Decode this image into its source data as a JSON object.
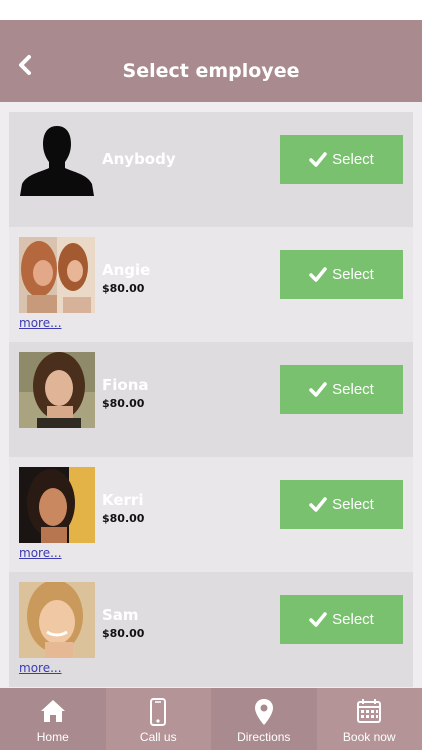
{
  "header": {
    "title": "Select employee",
    "back_icon": "chevron-left-icon"
  },
  "employees": [
    {
      "name": "Anybody",
      "price": "",
      "more": "",
      "select_label": "Select"
    },
    {
      "name": "Angie",
      "price": "$80.00",
      "more": "more...",
      "select_label": "Select"
    },
    {
      "name": "Fiona",
      "price": "$80.00",
      "more": "",
      "select_label": "Select"
    },
    {
      "name": "Kerri",
      "price": "$80.00",
      "more": "more...",
      "select_label": "Select"
    },
    {
      "name": "Sam",
      "price": "$80.00",
      "more": "more...",
      "select_label": "Select"
    }
  ],
  "tabbar": {
    "tabs": [
      {
        "label": "Home",
        "icon": "home-icon",
        "color": "#a98b8f"
      },
      {
        "label": "Call us",
        "icon": "phone-icon",
        "color": "#b49497"
      },
      {
        "label": "Directions",
        "icon": "location-pin-icon",
        "color": "#a98b8f"
      },
      {
        "label": "Book now",
        "icon": "calendar-icon",
        "color": "#b49497"
      }
    ]
  },
  "colors": {
    "header": "#a98b8f",
    "select_button": "#79c16f",
    "row_dark": "#dedcdf",
    "row_light": "#e9e7ea",
    "link": "#3b3bb0"
  }
}
